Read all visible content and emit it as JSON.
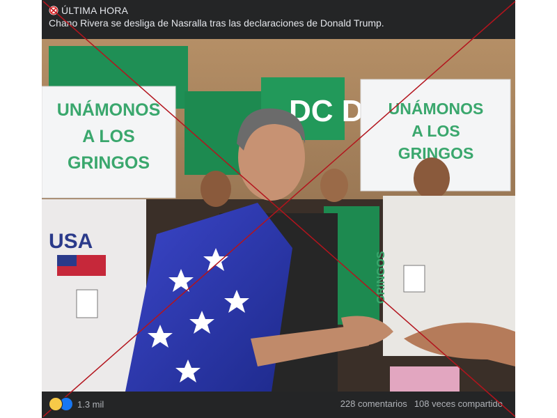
{
  "post": {
    "badge_label": "ÚLTIMA HORA",
    "badge_icon": "no-entry-icon",
    "text": "Chano Rivera se desliga de Nasralla tras las declaraciones de Donald Trump."
  },
  "photo": {
    "sign_left": {
      "line1": "UNÁMONOS",
      "line2": "A LOS",
      "line3": "GRINGOS"
    },
    "sign_right": {
      "line1": "UNÁMONOS",
      "line2": "A LOS",
      "line3": "GRINGOS"
    },
    "banner_text": "DC DC",
    "shirt_text": "USA",
    "sign_side_text": "GRINGOS",
    "colors": {
      "sign_text": "#3aa76d",
      "banner": "#1f8f55",
      "x_mark": "#b3141d"
    }
  },
  "footer": {
    "reaction_icons": [
      "haha-icon",
      "like-icon"
    ],
    "reaction_count": "1.3 mil",
    "comments": "228 comentarios",
    "shares": "108 veces compartido"
  }
}
